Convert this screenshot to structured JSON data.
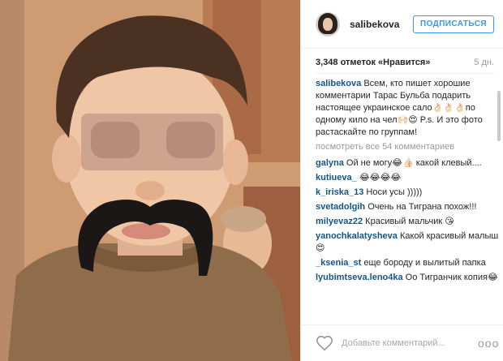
{
  "post": {
    "author": "salibekova",
    "follow_label": "ПОДПИСАТЬСЯ",
    "likes": "3,348 отметок «Нравится»",
    "age": "5 дн.",
    "caption": {
      "user": "salibekova",
      "text": "Всем, кто пишет хорошие комментарии Тарас Бульба подарить настоящее украинское сало👌🏻👌🏻👌🏻по одному кило на чел🙌🏻😍 P.s. И это фото растаскайте по группам!"
    },
    "view_all": "посмотреть все 54 комментариев",
    "comments": [
      {
        "user": "galyna",
        "text": "Ой не могу😂👍🏻 какой клевый...."
      },
      {
        "user": "kutiueva_",
        "text": "😂😂😂😂"
      },
      {
        "user": "k_iriska_13",
        "text": "Носи усы )))))"
      },
      {
        "user": "svetadolgih",
        "text": "Очень на Тиграна похож!!!"
      },
      {
        "user": "milyevaz22",
        "text": "Красивый мальчик 😘"
      },
      {
        "user": "yanochkalatysheva",
        "text": "Какой красивый малыш😍"
      },
      {
        "user": "_ksenia_st",
        "text": "еще бороду и вылитый папка"
      },
      {
        "user": "lyubimtseva.leno4ka",
        "text": "Оо Тигранчик копия😂"
      }
    ],
    "add_comment_placeholder": "Добавьте комментарий...",
    "options": "ooo"
  },
  "icons": {
    "heart": "heart-icon",
    "options": "more-options-icon",
    "avatar": "profile-avatar"
  },
  "colors": {
    "accent": "#3897f0",
    "username": "#125688",
    "muted": "#999999"
  }
}
